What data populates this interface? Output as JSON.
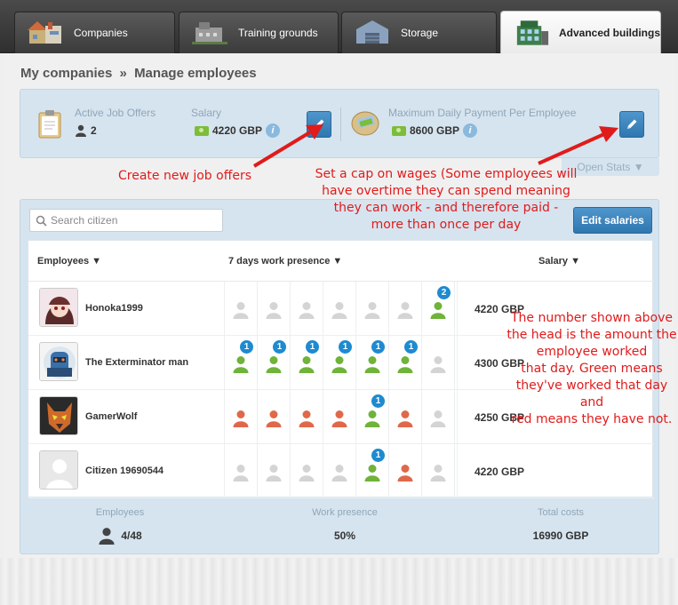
{
  "tabs": [
    {
      "label": "Companies",
      "icon": "companies-icon",
      "active": false
    },
    {
      "label": "Training grounds",
      "icon": "training-grounds-icon",
      "active": false
    },
    {
      "label": "Storage",
      "icon": "storage-icon",
      "active": false
    },
    {
      "label": "Advanced buildings",
      "icon": "advanced-buildings-icon",
      "active": true
    }
  ],
  "breadcrumb": {
    "parent": "My companies",
    "separator": "»",
    "current": "Manage employees"
  },
  "stats": {
    "active_job_offers_label": "Active Job Offers",
    "active_job_offers_value": "2",
    "salary_label": "Salary",
    "salary_value": "4220 GBP",
    "max_payment_label": "Maximum Daily Payment Per Employee",
    "max_payment_value": "8600 GBP",
    "open_stats": "Open Stats ▼"
  },
  "search": {
    "placeholder": "Search citizen"
  },
  "edit_salaries_label": "Edit salaries",
  "table": {
    "headers": {
      "employees": "Employees ▼",
      "presence": "7 days work presence ▼",
      "salary": "Salary ▼"
    },
    "rows": [
      {
        "name": "Honoka1999",
        "salary": "4220 GBP",
        "avatar": "anime-girl-avatar",
        "presence": [
          {
            "s": "none"
          },
          {
            "s": "none"
          },
          {
            "s": "none"
          },
          {
            "s": "none"
          },
          {
            "s": "none"
          },
          {
            "s": "none"
          },
          {
            "s": "worked",
            "n": "2"
          }
        ]
      },
      {
        "name": "The Exterminator man",
        "salary": "4300 GBP",
        "avatar": "robot-avatar",
        "presence": [
          {
            "s": "worked",
            "n": "1"
          },
          {
            "s": "worked",
            "n": "1"
          },
          {
            "s": "worked",
            "n": "1"
          },
          {
            "s": "worked",
            "n": "1"
          },
          {
            "s": "worked",
            "n": "1"
          },
          {
            "s": "worked",
            "n": "1"
          },
          {
            "s": "none"
          }
        ]
      },
      {
        "name": "GamerWolf",
        "salary": "4250 GBP",
        "avatar": "wolf-avatar",
        "presence": [
          {
            "s": "missed"
          },
          {
            "s": "missed"
          },
          {
            "s": "missed"
          },
          {
            "s": "missed"
          },
          {
            "s": "worked",
            "n": "1"
          },
          {
            "s": "missed"
          },
          {
            "s": "none"
          }
        ]
      },
      {
        "name": "Citizen 19690544",
        "salary": "4220 GBP",
        "avatar": "default-avatar",
        "presence": [
          {
            "s": "none"
          },
          {
            "s": "none"
          },
          {
            "s": "none"
          },
          {
            "s": "none"
          },
          {
            "s": "worked",
            "n": "1"
          },
          {
            "s": "missed"
          },
          {
            "s": "none"
          }
        ]
      }
    ]
  },
  "footer": {
    "employees_label": "Employees",
    "employees_value": "4/48",
    "presence_label": "Work presence",
    "presence_value": "50%",
    "costs_label": "Total costs",
    "costs_value": "16990 GBP"
  },
  "annotations": {
    "create_offers": "Create new job offers",
    "cap_wages": [
      "Set a cap on wages (Some employees will",
      "have overtime they can spend meaning",
      "they can work - and therefore paid -",
      "more than once per day"
    ],
    "number_explain": [
      "The number shown above",
      "the head is the amount the",
      "employee worked",
      "that day. Green means",
      "they've worked that day and",
      "red means they have not."
    ]
  },
  "colors": {
    "accent": "#2f77b0",
    "worked": "#6fb33a",
    "missed": "#e0684a",
    "none": "#d4d4d4",
    "annotation": "#e01b1b"
  }
}
